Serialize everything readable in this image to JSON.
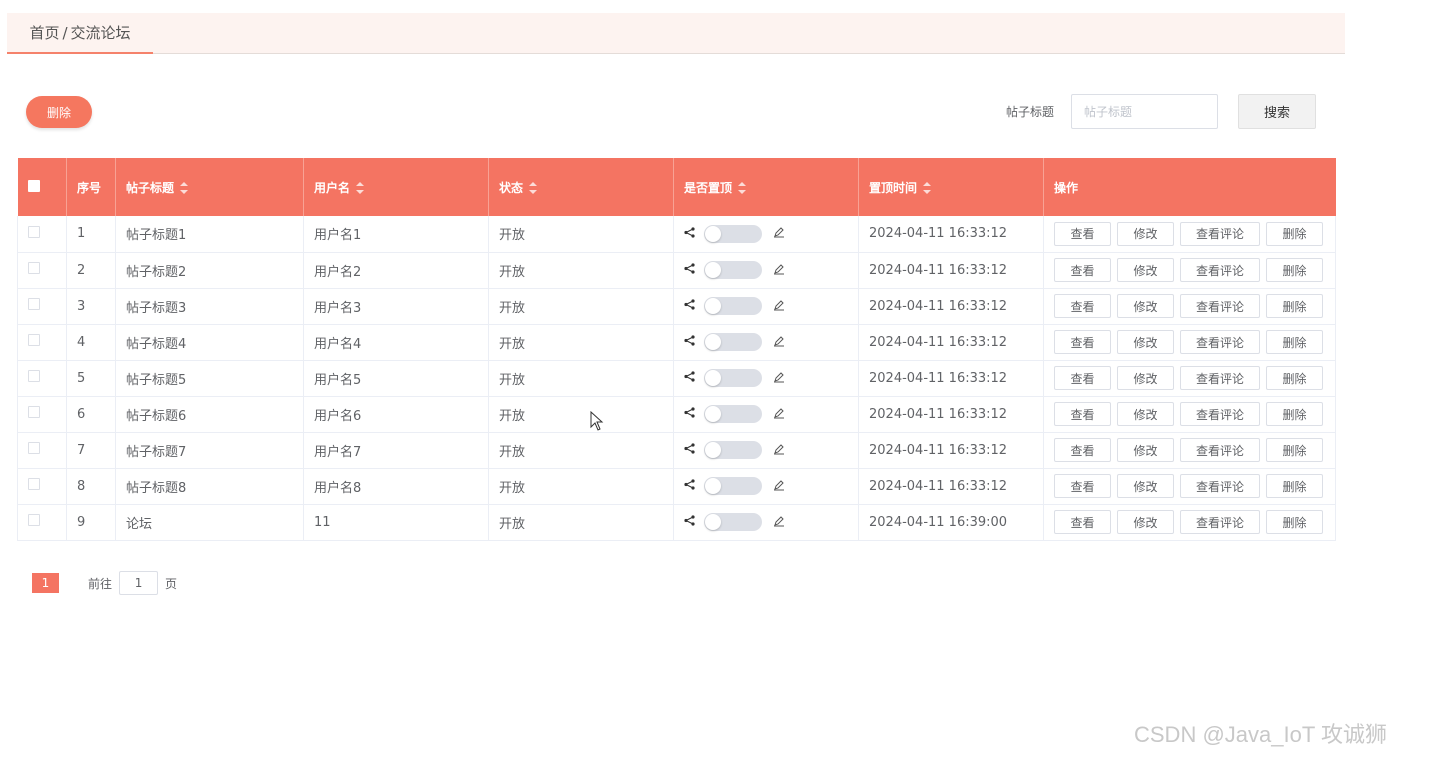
{
  "breadcrumb": {
    "home": "首页",
    "separator": "/",
    "current": "交流论坛"
  },
  "toolbar": {
    "delete_label": "删除"
  },
  "search": {
    "label": "帖子标题",
    "placeholder": "帖子标题",
    "value": "",
    "button_label": "搜索"
  },
  "table": {
    "headers": {
      "index": "序号",
      "title": "帖子标题",
      "username": "用户名",
      "status": "状态",
      "is_top": "是否置顶",
      "top_time": "置顶时间",
      "actions": "操作"
    },
    "action_labels": {
      "view": "查看",
      "edit": "修改",
      "comments": "查看评论",
      "delete": "删除"
    },
    "rows": [
      {
        "index": "1",
        "title": "帖子标题1",
        "username": "用户名1",
        "status": "开放",
        "top_time": "2024-04-11 16:33:12",
        "is_top": false
      },
      {
        "index": "2",
        "title": "帖子标题2",
        "username": "用户名2",
        "status": "开放",
        "top_time": "2024-04-11 16:33:12",
        "is_top": false
      },
      {
        "index": "3",
        "title": "帖子标题3",
        "username": "用户名3",
        "status": "开放",
        "top_time": "2024-04-11 16:33:12",
        "is_top": false
      },
      {
        "index": "4",
        "title": "帖子标题4",
        "username": "用户名4",
        "status": "开放",
        "top_time": "2024-04-11 16:33:12",
        "is_top": false
      },
      {
        "index": "5",
        "title": "帖子标题5",
        "username": "用户名5",
        "status": "开放",
        "top_time": "2024-04-11 16:33:12",
        "is_top": false
      },
      {
        "index": "6",
        "title": "帖子标题6",
        "username": "用户名6",
        "status": "开放",
        "top_time": "2024-04-11 16:33:12",
        "is_top": false
      },
      {
        "index": "7",
        "title": "帖子标题7",
        "username": "用户名7",
        "status": "开放",
        "top_time": "2024-04-11 16:33:12",
        "is_top": false
      },
      {
        "index": "8",
        "title": "帖子标题8",
        "username": "用户名8",
        "status": "开放",
        "top_time": "2024-04-11 16:33:12",
        "is_top": false
      },
      {
        "index": "9",
        "title": "论坛",
        "username": "11",
        "status": "开放",
        "top_time": "2024-04-11 16:39:00",
        "is_top": false
      }
    ]
  },
  "pagination": {
    "current_page": "1",
    "goto_label": "前往",
    "goto_value": "1",
    "unit_label": "页"
  },
  "watermark": "CSDN @Java_IoT 攻诚狮",
  "colors": {
    "accent": "#f47462",
    "delete_button": "#f5775f",
    "tab_bg": "#fdf3f0"
  },
  "icons": {
    "share": "share-icon",
    "edit": "pencil-icon",
    "sort": "sort-caret-icon"
  }
}
